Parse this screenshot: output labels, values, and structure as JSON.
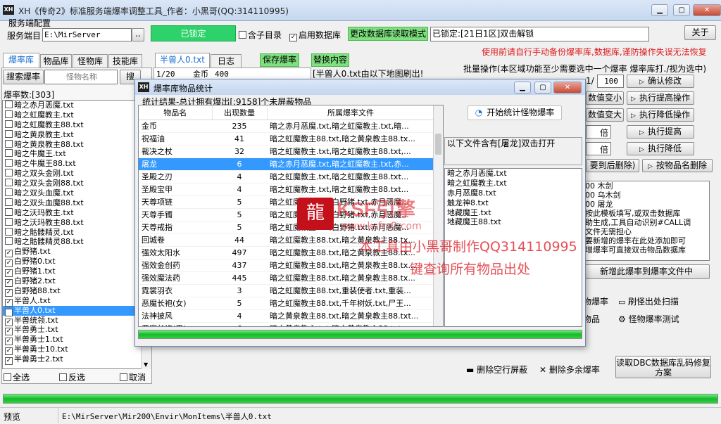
{
  "app": {
    "logo": "XH",
    "title": "XH《传奇2》标准服务端爆率调整工具_作者：小黑哥(QQ:314110995)"
  },
  "server": {
    "config_label": "服务端配置",
    "dir_label": "服务端目",
    "dir_value": "E:\\MirServer",
    "browse": "..",
    "locked_btn": "已锁定",
    "sub_dir_check": "含子目录",
    "use_db_check": "启用数据库",
    "change_db_mode": "更改数据库读取模式",
    "locked_status": "已锁定:[21日1区]双击解锁",
    "about": "关于"
  },
  "warning": "使用前请自行手动备份爆率库,数据库,谨防操作失误无法恢复",
  "left_tabs": [
    "爆率库",
    "物品库",
    "怪物库",
    "技能库"
  ],
  "search": {
    "label": "搜索爆率",
    "placeholder": "怪物名称",
    "btn": "搜"
  },
  "drop_count": "爆率数:[303]",
  "file_list": [
    {
      "name": "暗之赤月恶魔.txt",
      "checked": false
    },
    {
      "name": "暗之虹魔教主.txt",
      "checked": false
    },
    {
      "name": "暗之虹魔教主88.txt",
      "checked": false
    },
    {
      "name": "暗之黄泉教主.txt",
      "checked": false
    },
    {
      "name": "暗之黄泉教主88.txt",
      "checked": false
    },
    {
      "name": "暗之牛魔王.txt",
      "checked": false
    },
    {
      "name": "暗之牛魔王88.txt",
      "checked": false
    },
    {
      "name": "暗之双头金刚.txt",
      "checked": false
    },
    {
      "name": "暗之双头金刚88.txt",
      "checked": false
    },
    {
      "name": "暗之双头血魔.txt",
      "checked": false
    },
    {
      "name": "暗之双头血魔88.txt",
      "checked": false
    },
    {
      "name": "暗之沃玛教主.txt",
      "checked": false
    },
    {
      "name": "暗之沃玛教主88.txt",
      "checked": false
    },
    {
      "name": "暗之骷髅精灵.txt",
      "checked": false
    },
    {
      "name": "暗之骷髅精灵88.txt",
      "checked": false
    },
    {
      "name": "白野猪.txt",
      "checked": true
    },
    {
      "name": "白野猪0.txt",
      "checked": true
    },
    {
      "name": "白野猪1.txt",
      "checked": true
    },
    {
      "name": "白野猪2.txt",
      "checked": true
    },
    {
      "name": "白野猪88.txt",
      "checked": true
    },
    {
      "name": "半兽人.txt",
      "checked": true
    },
    {
      "name": "半兽人0.txt",
      "checked": true,
      "selected": true
    },
    {
      "name": "半兽统领.txt",
      "checked": true
    },
    {
      "name": "半兽勇士.txt",
      "checked": true
    },
    {
      "name": "半兽勇士1.txt",
      "checked": true
    },
    {
      "name": "半兽勇士10.txt",
      "checked": true
    },
    {
      "name": "半兽勇士2.txt",
      "checked": true
    }
  ],
  "list_footer": {
    "select_all": "全选",
    "invert": "反选",
    "cancel": "取消"
  },
  "middle_tabs": {
    "file_tab": "半兽人0.txt",
    "log_tab": "日志",
    "save_btn": "保存爆率",
    "replace_btn": "替换内容"
  },
  "editor_line": {
    "ratio": "1/20",
    "item": "金币",
    "amount": "400"
  },
  "map_note": "[半兽人0.txt由以下地图刷出!",
  "batch": {
    "title": "批量操作(本区域功能至少需要选中一个爆率 爆率库打./视为选中)",
    "ratio_left": "1/",
    "ratio_right": "100",
    "confirm": "确认修改",
    "dec": "数值变小",
    "raise": "执行提高操作",
    "inc": "数值变大",
    "lower": "执行降低操作",
    "mult1": "倍",
    "exec_raise": "执行提高",
    "mult2": "倍",
    "exec_lower": "执行降低",
    "delete_to": "要到后删除)",
    "delete_by_name": "按物品名删除"
  },
  "right_list": [
    "00 木剑",
    "00 乌木剑",
    "00 屠龙",
    "按此模板填写,或双击数据库",
    "助生成,工具自动识别#CALL调",
    "文件无需担心",
    "要新增的爆率在此处添加即可",
    "增爆率可直接双击物品数据库"
  ],
  "add_drop": "新增此爆率到爆率文件中",
  "right_bottom": {
    "monster_drop": "物爆率",
    "refresh_scan": "刷怪出处扫描",
    "items": "物品",
    "monster_test": "怪物爆率测试",
    "del_empty": "删除空行屏蔽",
    "del_extra": "删除多余爆率",
    "read_dbc": "读取DBC数据库乱码修复方案"
  },
  "status": {
    "preview_label": "预览",
    "path": "E:\\MirServer\\Mir200\\Envir\\MonItems\\半兽人0.txt"
  },
  "dialog": {
    "title": "爆率库物品统计",
    "summary": "统计结果-总计拥有爆出[:9158]个未屏蔽物品",
    "start_btn": "开始统计怪物爆率",
    "note": "以下文件含有[屠龙]双击打开",
    "columns": [
      "物品名",
      "出现数量",
      "所属爆率文件"
    ],
    "rows": [
      {
        "name": "金币",
        "count": "235",
        "files": "暗之赤月恶魔.txt,暗之虹魔教主.txt,暗..."
      },
      {
        "name": "祝福油",
        "count": "41",
        "files": "暗之虹魔教主88.txt,暗之黄泉教主88.tx..."
      },
      {
        "name": "裁决之杖",
        "count": "32",
        "files": "暗之虹魔教主.txt,暗之虹魔教主88.txt,..."
      },
      {
        "name": "屠龙",
        "count": "6",
        "files": "暗之赤月恶魔.txt,暗之虹魔教主.txt,赤...",
        "selected": true
      },
      {
        "name": "圣殿之刃",
        "count": "4",
        "files": "暗之虹魔教主.txt,暗之虹魔教主88.txt..."
      },
      {
        "name": "圣殿宝甲",
        "count": "4",
        "files": "暗之虹魔教主.txt,暗之虹魔教主88.txt..."
      },
      {
        "name": "天尊项链",
        "count": "5",
        "files": "暗之虹魔教主.txt,白野猪.txt,赤月恶魔..."
      },
      {
        "name": "天尊手镯",
        "count": "5",
        "files": "暗之虹魔教主.txt,白野猪.txt,赤月恶魔..."
      },
      {
        "name": "天尊戒指",
        "count": "5",
        "files": "暗之虹魔教主.txt,白野猪.txt,赤月恶魔..."
      },
      {
        "name": "回城卷",
        "count": "44",
        "files": "暗之虹魔教主88.txt,暗之黄泉教主88.tx..."
      },
      {
        "name": "强效太阳水",
        "count": "497",
        "files": "暗之虹魔教主88.txt,暗之黄泉教主88.tx..."
      },
      {
        "name": "强效金创药",
        "count": "437",
        "files": "暗之虹魔教主88.txt,暗之黄泉教主88.tx..."
      },
      {
        "name": "强效魔法药",
        "count": "445",
        "files": "暗之虹魔教主88.txt,暗之黄泉教主88.tx..."
      },
      {
        "name": "霓裳羽衣",
        "count": "3",
        "files": "暗之虹魔教主88.txt,重装使者.txt,重装..."
      },
      {
        "name": "恶魔长袍(女)",
        "count": "5",
        "files": "暗之虹魔教主88.txt,千年树妖.txt,尸王..."
      },
      {
        "name": "法神披风",
        "count": "4",
        "files": "暗之黄泉教主88.txt,暗之黄泉教主88.txt..."
      },
      {
        "name": "恶魔长袍(男)",
        "count": "6",
        "files": "暗之黄泉教主.txt,暗之黄泉教主88.txt,..."
      },
      {
        "name": "",
        "count": "",
        "files": ""
      }
    ],
    "files": [
      "暗之赤月恶魔.txt",
      "暗之虹魔教主.txt",
      "赤月恶魔8.txt",
      "触龙神8.txt",
      "地藏魔王.txt",
      "地藏魔王88.txt"
    ],
    "progress": 1.0
  },
  "watermark": {
    "logo": "龍",
    "brand": "KSF引擎",
    "url": "www.ksfm2.com",
    "line1": "本工具由小黑哥制作QQ314110995",
    "line2": "键查询所有物品出处"
  },
  "colors": {
    "accent_green": "#2ed26a",
    "warning_red": "#e0181c",
    "selection_blue": "#3399ff"
  }
}
